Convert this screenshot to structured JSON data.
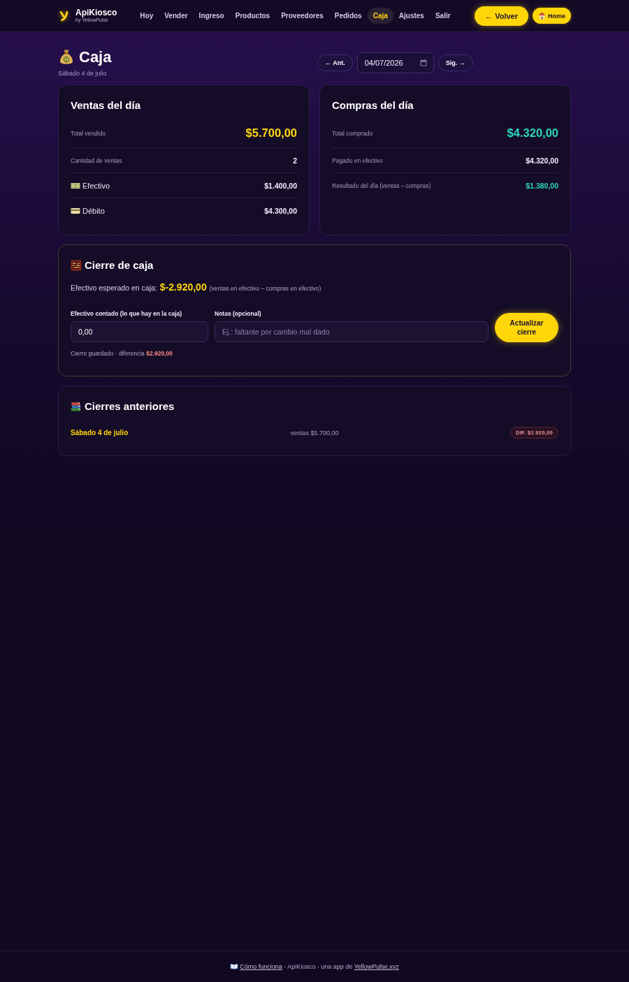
{
  "header": {
    "brand": "ApiKiosco",
    "brand_subtitle": "by YellowPulse",
    "nav": [
      {
        "label": "Hoy",
        "selected": false
      },
      {
        "label": "Vender",
        "selected": false
      },
      {
        "label": "Ingreso",
        "selected": false
      },
      {
        "label": "Productos",
        "selected": false
      },
      {
        "label": "Proveedores",
        "selected": false
      },
      {
        "label": "Pedidos",
        "selected": false
      },
      {
        "label": "Caja",
        "selected": true
      },
      {
        "label": "Ajustes",
        "selected": false
      },
      {
        "label": "Salir",
        "selected": false
      }
    ],
    "buttons": [
      {
        "label": "← Volver",
        "kind": "back"
      },
      {
        "label": "Home",
        "kind": "home"
      }
    ]
  },
  "page_header": {
    "title": "Caja",
    "subtitle": "Sábado 4 de julio",
    "prev_button": "← Ant.",
    "date": "04/07/2026",
    "next_button": "Sig. →"
  },
  "summary_cards": [
    {
      "title": "Ventas del día",
      "rows": [
        {
          "kind": "total",
          "label": "Total vendido",
          "value": "$5.700,00",
          "color": "#ffd60a"
        },
        {
          "kind": "stat",
          "label": "Cantidad de ventas",
          "value": "2"
        },
        {
          "kind": "cash",
          "label": "Efectivo",
          "value": "$1.400,00"
        },
        {
          "kind": "debit",
          "label": "Débito",
          "value": "$4.300,00"
        }
      ]
    },
    {
      "title": "Compras del día",
      "rows": [
        {
          "kind": "total",
          "label": "Total comprado",
          "value": "$4.320,00",
          "color": "#2dd4bf"
        },
        {
          "kind": "stat",
          "label": "Pagado en efectivo",
          "value": "$4.320,00"
        },
        {
          "kind": "stat",
          "label": "Resultado del día (ventas – compras)",
          "value": "$1.380,00",
          "color": "#2dd4bf"
        }
      ]
    }
  ],
  "cash_closing": {
    "title": "Cierre de caja",
    "expected_label": "Efectivo esperado en caja:",
    "expected_amount": "$-2.920,00",
    "expected_note": "(ventas en efectivo – compras en efectivo)",
    "counted_label": "Efectivo contado (lo que hay en la caja)",
    "counted_value": "0,00",
    "notes_label": "Notas (opcional)",
    "notes_placeholder": "Ej.: faltante por cambio mal dado",
    "submit_button": "Actualizar cierre",
    "status": "Cierre guardado · diferencia **$2.920,00**"
  },
  "previous_closings": {
    "title": "Cierres anteriores",
    "rows": [
      {
        "date": "Sábado 4 de julio",
        "sales": "ventas $5.700,00",
        "difference": "DIF. $2.920,00"
      }
    ]
  },
  "footer": {
    "help_link": "Cómo funciona",
    "text": "· ApiKiosco · una app de",
    "site_link": "YellowPulse.xyz"
  }
}
